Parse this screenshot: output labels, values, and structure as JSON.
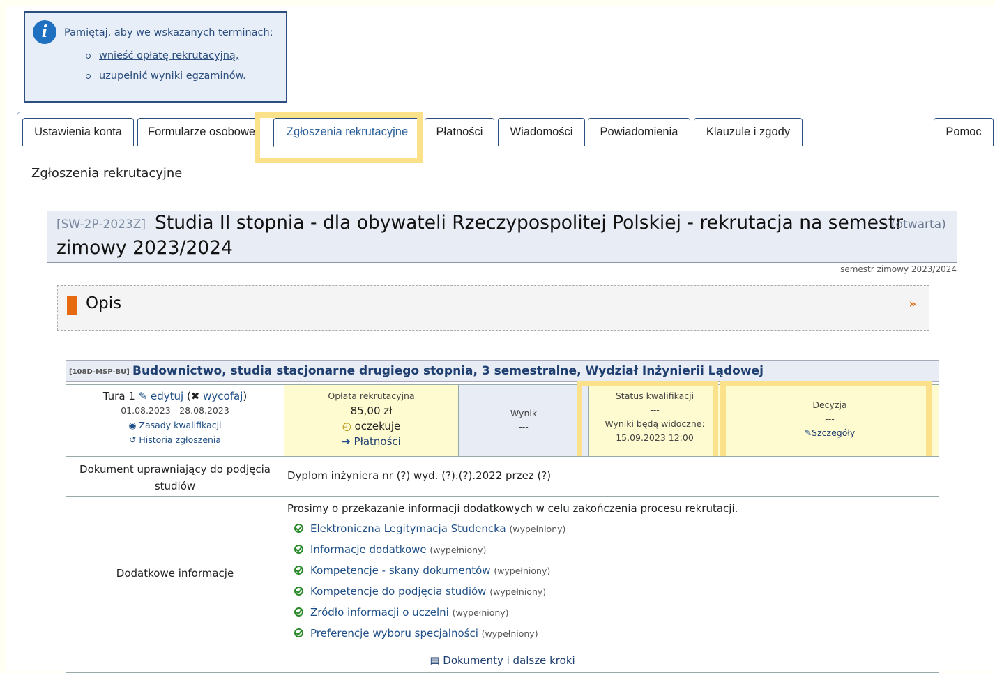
{
  "info_box": {
    "text": "Pamiętaj, aby we wskazanych terminach:",
    "links": [
      "wnieść opłatę rekrutacyjną,",
      "uzupełnić wyniki egzaminów."
    ]
  },
  "tabs": [
    {
      "label": "Ustawienia konta"
    },
    {
      "label": "Formularze osobowe"
    },
    {
      "label": "Zgłoszenia rekrutacyjne"
    },
    {
      "label": "Płatności"
    },
    {
      "label": "Wiadomości"
    },
    {
      "label": "Powiadomienia"
    },
    {
      "label": "Klauzule i zgody"
    },
    {
      "label": "Pomoc"
    }
  ],
  "section_title": "Zgłoszenia rekrutacyjne",
  "recruitment": {
    "code": "[SW-2P-2023Z]",
    "title_line1": "Studia II stopnia - dla obywateli Rzeczypospolitej Polskiej - rekrutacja na semestr",
    "status": "(otwarta)",
    "title_line2": "zimowy 2023/2024",
    "semester": "semestr zimowy 2023/2024"
  },
  "opis": {
    "title": "Opis"
  },
  "program": {
    "code": "[108D-MSP-BU]",
    "name": "Budownictwo, studia stacjonarne drugiego stopnia, 3 semestralne, Wydział Inżynierii Lądowej"
  },
  "tura": {
    "label": "Tura 1",
    "edit": "edytuj",
    "withdraw": "wycofaj",
    "dates": "01.08.2023 - 28.08.2023",
    "rules": "Zasady kwalifikacji",
    "history": "Historia zgłoszenia"
  },
  "fee": {
    "label": "Opłata rekrutacyjna",
    "amount": "85,00 zł",
    "status": "oczekuje",
    "payments": "Płatności"
  },
  "result": {
    "label": "Wynik",
    "value": "---"
  },
  "qualification": {
    "label": "Status kwalifikacji",
    "value": "---",
    "visible_label": "Wyniki będą widoczne:",
    "visible_date": "15.09.2023 12:00"
  },
  "decision": {
    "label": "Decyzja",
    "value": "---",
    "details": "Szczegóły"
  },
  "document": {
    "label": "Dokument uprawniający do podjęcia studiów",
    "value": "Dyplom inżyniera nr (?) wyd. (?).(?).2022 przez (?)"
  },
  "additional": {
    "label": "Dodatkowe informacje",
    "intro": "Prosimy o przekazanie informacji dodatkowych w celu zakończenia procesu rekrutacji.",
    "filled_label": "(wypełniony)",
    "items": [
      {
        "label": "Elektroniczna Legitymacja Studencka"
      },
      {
        "label": "Informacje dodatkowe"
      },
      {
        "label": "Kompetencje - skany dokumentów"
      },
      {
        "label": "Kompetencje do podjęcia studiów"
      },
      {
        "label": "Źródło informacji o uczelni"
      },
      {
        "label": "Preferencje wyboru specjalności"
      }
    ]
  },
  "footer_link": "Dokumenty i dalsze kroki"
}
